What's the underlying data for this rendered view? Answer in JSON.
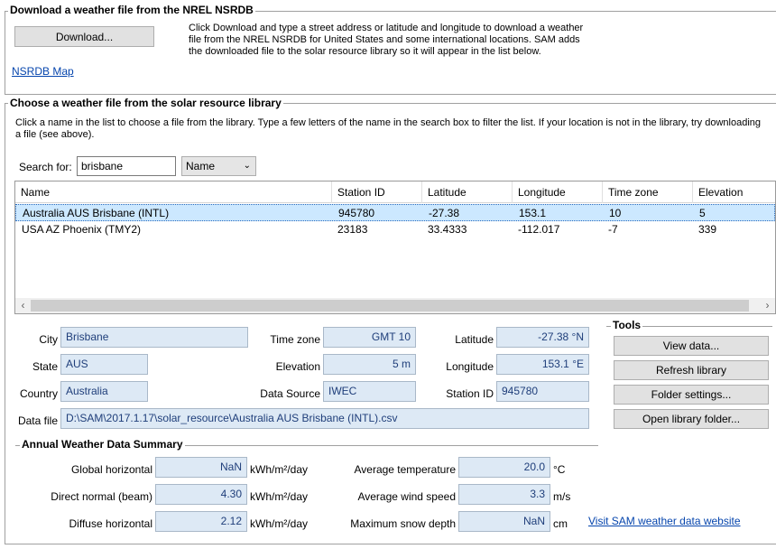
{
  "nsrdb": {
    "title": "Download a weather file from the NREL NSRDB",
    "download_label": "Download...",
    "description": "Click Download and type a street address or latitude and longitude to download a weather file from the NREL NSRDB for United States and some international locations. SAM adds the downloaded file to the solar resource library so it will appear in the list below.",
    "map_link": "NSRDB Map"
  },
  "library": {
    "title": "Choose a weather file from the solar resource library",
    "description": "Click a name in the list to choose a file from the library. Type a few letters of the name in the search box to filter the list.  If your location is not in the library, try downloading a file (see above).",
    "search_label": "Search for:",
    "search_value": "brisbane",
    "filter_value": "Name",
    "columns": [
      "Name",
      "Station ID",
      "Latitude",
      "Longitude",
      "Time zone",
      "Elevation"
    ],
    "rows": [
      [
        "Australia AUS Brisbane (INTL)",
        "945780",
        "-27.38",
        "153.1",
        "10",
        "5"
      ],
      [
        "USA AZ Phoenix (TMY2)",
        "23183",
        "33.4333",
        "-112.017",
        "-7",
        "339"
      ]
    ]
  },
  "details": {
    "city_label": "City",
    "city": "Brisbane",
    "state_label": "State",
    "state": "AUS",
    "country_label": "Country",
    "country": "Australia",
    "timezone_label": "Time zone",
    "timezone": "GMT 10",
    "elevation_label": "Elevation",
    "elevation": "5 m",
    "datasource_label": "Data Source",
    "datasource": "IWEC",
    "latitude_label": "Latitude",
    "latitude": "-27.38 °N",
    "longitude_label": "Longitude",
    "longitude": "153.1 °E",
    "stationid_label": "Station ID",
    "stationid": "945780",
    "datafile_label": "Data file",
    "datafile": "D:\\SAM\\2017.1.17\\solar_resource\\Australia AUS Brisbane (INTL).csv"
  },
  "tools": {
    "title": "Tools",
    "view_data": "View data...",
    "refresh": "Refresh library",
    "folder_settings": "Folder settings...",
    "open_folder": "Open library folder..."
  },
  "summary": {
    "title": "Annual Weather Data Summary",
    "global_label": "Global horizontal",
    "global": "NaN",
    "global_unit": "kWh/m²/day",
    "direct_label": "Direct normal (beam)",
    "direct": "4.30",
    "direct_unit": "kWh/m²/day",
    "diffuse_label": "Diffuse horizontal",
    "diffuse": "2.12",
    "diffuse_unit": "kWh/m²/day",
    "temp_label": "Average temperature",
    "temp": "20.0",
    "temp_unit": "°C",
    "wind_label": "Average wind speed",
    "wind": "3.3",
    "wind_unit": "m/s",
    "snow_label": "Maximum snow depth",
    "snow": "NaN",
    "snow_unit": "cm",
    "website_link": "Visit SAM weather data website"
  },
  "colors": {
    "selected_row": "#cce8ff",
    "readonly_field": "#dde9f5",
    "link": "#0645ad"
  }
}
